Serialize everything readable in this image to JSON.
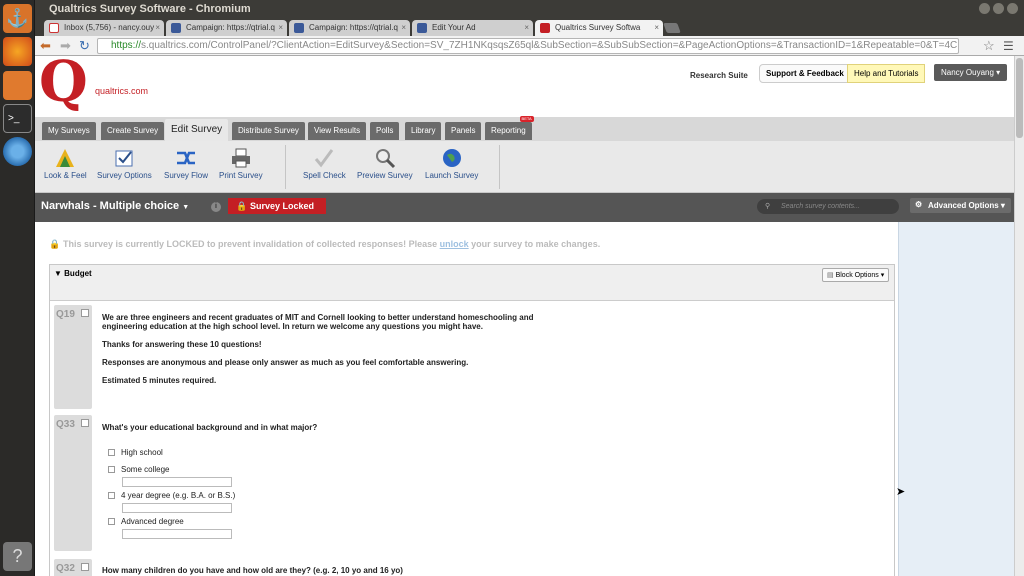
{
  "window": {
    "title": "Qualtrics Survey Software - Chromium"
  },
  "browser_tabs": [
    {
      "label": "Inbox (5,756) - nancy.ouy",
      "icon": "gmail-icon"
    },
    {
      "label": "Campaign: https://qtrial.q",
      "icon": "facebook-icon"
    },
    {
      "label": "Campaign: https://qtrial.q",
      "icon": "facebook-icon"
    },
    {
      "label": "Edit Your Ad",
      "icon": "facebook-icon"
    },
    {
      "label": "Qualtrics Survey Softwa",
      "icon": "qualtrics-icon"
    }
  ],
  "address": {
    "secure": "https://",
    "url": "s.qualtrics.com/ControlPanel/?ClientAction=EditSurvey&Section=SV_7ZH1NKqsqsZ65ql&SubSection=&SubSubSection=&PageActionOptions=&TransactionID=1&Repeatable=0&T=4CMGTu&req"
  },
  "header": {
    "logo_text": "qualtrics.com",
    "research_suite": "Research Suite",
    "support": "Support & Feedback",
    "help": "Help and Tutorials",
    "user": "Nancy Ouyang"
  },
  "main_tabs": [
    "My Surveys",
    "Create Survey",
    "Edit Survey",
    "Distribute Survey",
    "View Results",
    "Polls",
    "Library",
    "Panels",
    "Reporting"
  ],
  "beta_label": "BETA",
  "toolbar": [
    "Look & Feel",
    "Survey Options",
    "Survey Flow",
    "Print Survey",
    "Spell Check",
    "Preview Survey",
    "Launch Survey"
  ],
  "survey_bar": {
    "name": "Narwhals - Multiple choice",
    "locked": "Survey Locked",
    "search_placeholder": "Search survey contents...",
    "advanced": "Advanced Options"
  },
  "lock_message": {
    "before": "This survey is currently LOCKED to prevent invalidation of collected responses! Please ",
    "link": "unlock",
    "after": " your survey to make changes."
  },
  "block": {
    "title": "Budget",
    "options": "Block Options"
  },
  "questions": {
    "q19": {
      "num": "Q19",
      "l1": "We are three engineers and recent graduates of MIT and Cornell looking to better understand homeschooling and",
      "l2": "engineering education at the high school level. In return we welcome any questions you might have.",
      "l3": "Thanks for answering these 10 questions!",
      "l4": "Responses are anonymous and please only answer as much as you feel comfortable answering.",
      "l5": "Estimated 5 minutes required."
    },
    "q33": {
      "num": "Q33",
      "text": "What's your educational background and in what major?",
      "choices": [
        "High school",
        "Some college",
        "4 year degree (e.g. B.A. or B.S.)",
        "Advanced degree"
      ]
    },
    "q32": {
      "num": "Q32",
      "text": "How many children do you have and how old are they? (e.g. 2, 10 yo and 16 yo)"
    }
  }
}
